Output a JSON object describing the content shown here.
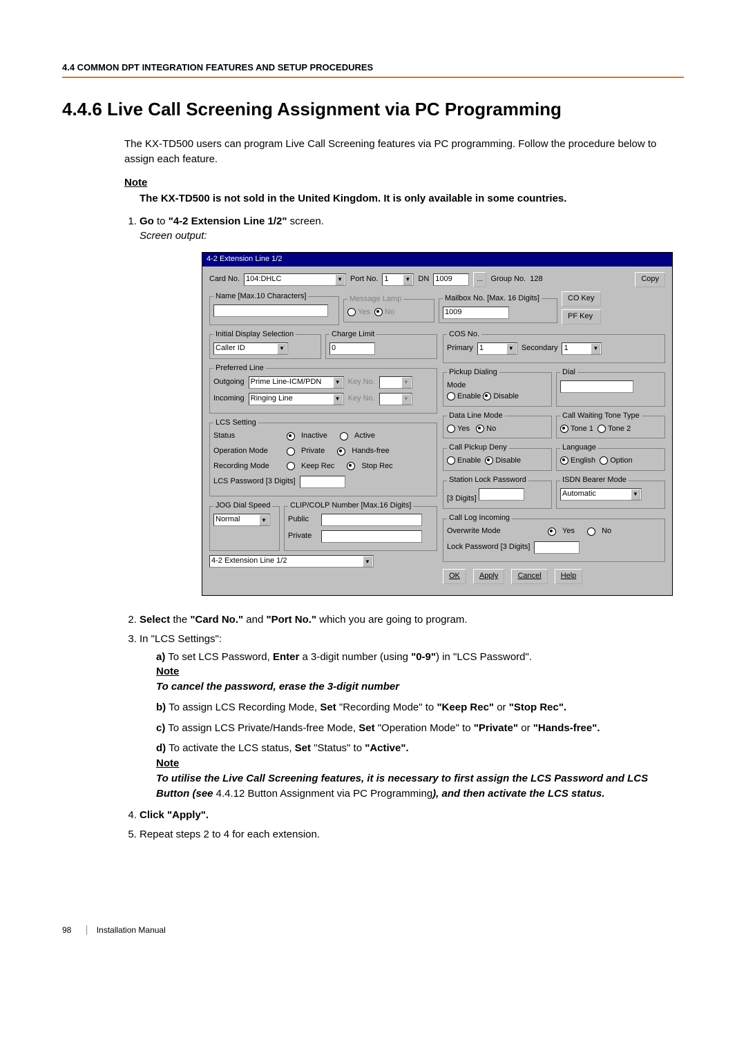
{
  "header": {
    "section": "4.4 COMMON DPT INTEGRATION FEATURES AND SETUP PROCEDURES"
  },
  "title": "4.4.6   Live Call Screening Assignment via PC Programming",
  "intro": "The KX-TD500 users can program Live Call Screening features via PC programming. Follow the procedure below to assign each feature.",
  "note_label": "Note",
  "note_body": "The KX-TD500 is not sold in the United Kingdom. It is only available in some countries.",
  "step1_a": "Go",
  "step1_b": " to ",
  "step1_c": "\"4-2 Extension Line 1/2\"",
  "step1_d": " screen.",
  "step1_sub": "Screen output:",
  "win": {
    "title": "4-2 Extension Line 1/2",
    "card_no_lbl": "Card No.",
    "card_no_val": "104:DHLC",
    "port_no_lbl": "Port No.",
    "port_no_val": "1",
    "dn_lbl": "DN",
    "dn_val": "1009",
    "dn_btn": "...",
    "group_lbl": "Group No.",
    "group_val": "128",
    "copy_btn": "Copy",
    "name_legend": "Name [Max.10 Characters]",
    "msg_legend": "Message Lamp",
    "msg_yes": "Yes",
    "msg_no": "No",
    "mailbox_legend": "Mailbox No. [Max. 16 Digits]",
    "mailbox_val": "1009",
    "co_key": "CO Key",
    "pf_key": "PF Key",
    "init_disp_legend": "Initial Display Selection",
    "init_disp_val": "Caller ID",
    "charge_legend": "Charge Limit",
    "charge_val": "0",
    "cos_legend": "COS No.",
    "cos_prim": "Primary",
    "cos_prim_v": "1",
    "cos_sec": "Secondary",
    "cos_sec_v": "1",
    "pref_legend": "Preferred Line",
    "pref_out": "Outgoing",
    "pref_out_v": "Prime Line-ICM/PDN",
    "pref_in": "Incoming",
    "pref_in_v": "Ringing Line",
    "key_no": "Key No.",
    "lcs_legend": "LCS Setting",
    "lcs_status": "Status",
    "lcs_inactive": "Inactive",
    "lcs_active": "Active",
    "lcs_op": "Operation Mode",
    "lcs_priv": "Private",
    "lcs_hf": "Hands-free",
    "lcs_rec": "Recording Mode",
    "lcs_keep": "Keep Rec",
    "lcs_stop": "Stop Rec",
    "lcs_pwd": "LCS Password [3 Digits]",
    "jog_legend": "JOG Dial Speed",
    "jog_val": "Normal",
    "clip_legend": "CLIP/COLP Number [Max.16 Digits]",
    "clip_pub": "Public",
    "clip_priv": "Private",
    "pickup_legend": "Pickup Dialing",
    "pickup_mode": "Mode",
    "enable": "Enable",
    "disable": "Disable",
    "dial_legend": "Dial",
    "dlm_legend": "Data Line Mode",
    "yes": "Yes",
    "no": "No",
    "cwt_legend": "Call Waiting Tone Type",
    "tone1": "Tone 1",
    "tone2": "Tone 2",
    "cpd_legend": "Call Pickup Deny",
    "lang_legend": "Language",
    "english": "English",
    "option": "Option",
    "slp_legend": "Station Lock Password",
    "slp_sub": "[3 Digits]",
    "isdn_legend": "ISDN Bearer Mode",
    "isdn_val": "Automatic",
    "cli_legend": "Call Log Incoming",
    "cli_ow": "Overwrite Mode",
    "cli_lock": "Lock Password [3 Digits]",
    "page_sel": "4-2 Extension Line 1/2",
    "ok": "OK",
    "apply": "Apply",
    "cancel": "Cancel",
    "help": "Help"
  },
  "step2_a": "Select",
  "step2_b": " the ",
  "step2_c": "\"Card No.\"",
  "step2_d": " and ",
  "step2_e": "\"Port No.\"",
  "step2_f": " which you are going to program.",
  "step3": "In \"LCS Settings\":",
  "step3a_1": "To set LCS Password, ",
  "step3a_2": "Enter",
  "step3a_3": " a 3-digit number (using ",
  "step3a_4": "\"0-9\"",
  "step3a_5": ") in \"LCS Password\".",
  "step3a_note": "To cancel the password, erase the 3-digit number",
  "step3b_1": "To assign LCS Recording Mode, ",
  "step3b_2": "Set",
  "step3b_3": " \"Recording Mode\" to ",
  "step3b_4": "\"Keep Rec\"",
  "step3b_5": " or ",
  "step3b_6": "\"Stop Rec\".",
  "step3c_1": "To assign LCS Private/Hands-free Mode, ",
  "step3c_2": "Set",
  "step3c_3": " \"Operation Mode\" to ",
  "step3c_4": "\"Private\"",
  "step3c_5": " or ",
  "step3c_6": "\"Hands-free\".",
  "step3d_1": "To activate the LCS status, ",
  "step3d_2": "Set",
  "step3d_3": " \"Status\" to ",
  "step3d_4": "\"Active\".",
  "step3d_note1": "To utilise the Live Call Screening features, it is necessary to first assign the LCS Password and LCS Button (see ",
  "step3d_note_ref": "4.4.12 Button Assignment via PC Programming",
  "step3d_note2": "), and then activate the LCS status.",
  "step4": "Click \"Apply\".",
  "step5": "Repeat steps 2 to 4 for each extension.",
  "footer_page": "98",
  "footer_txt": "Installation Manual"
}
